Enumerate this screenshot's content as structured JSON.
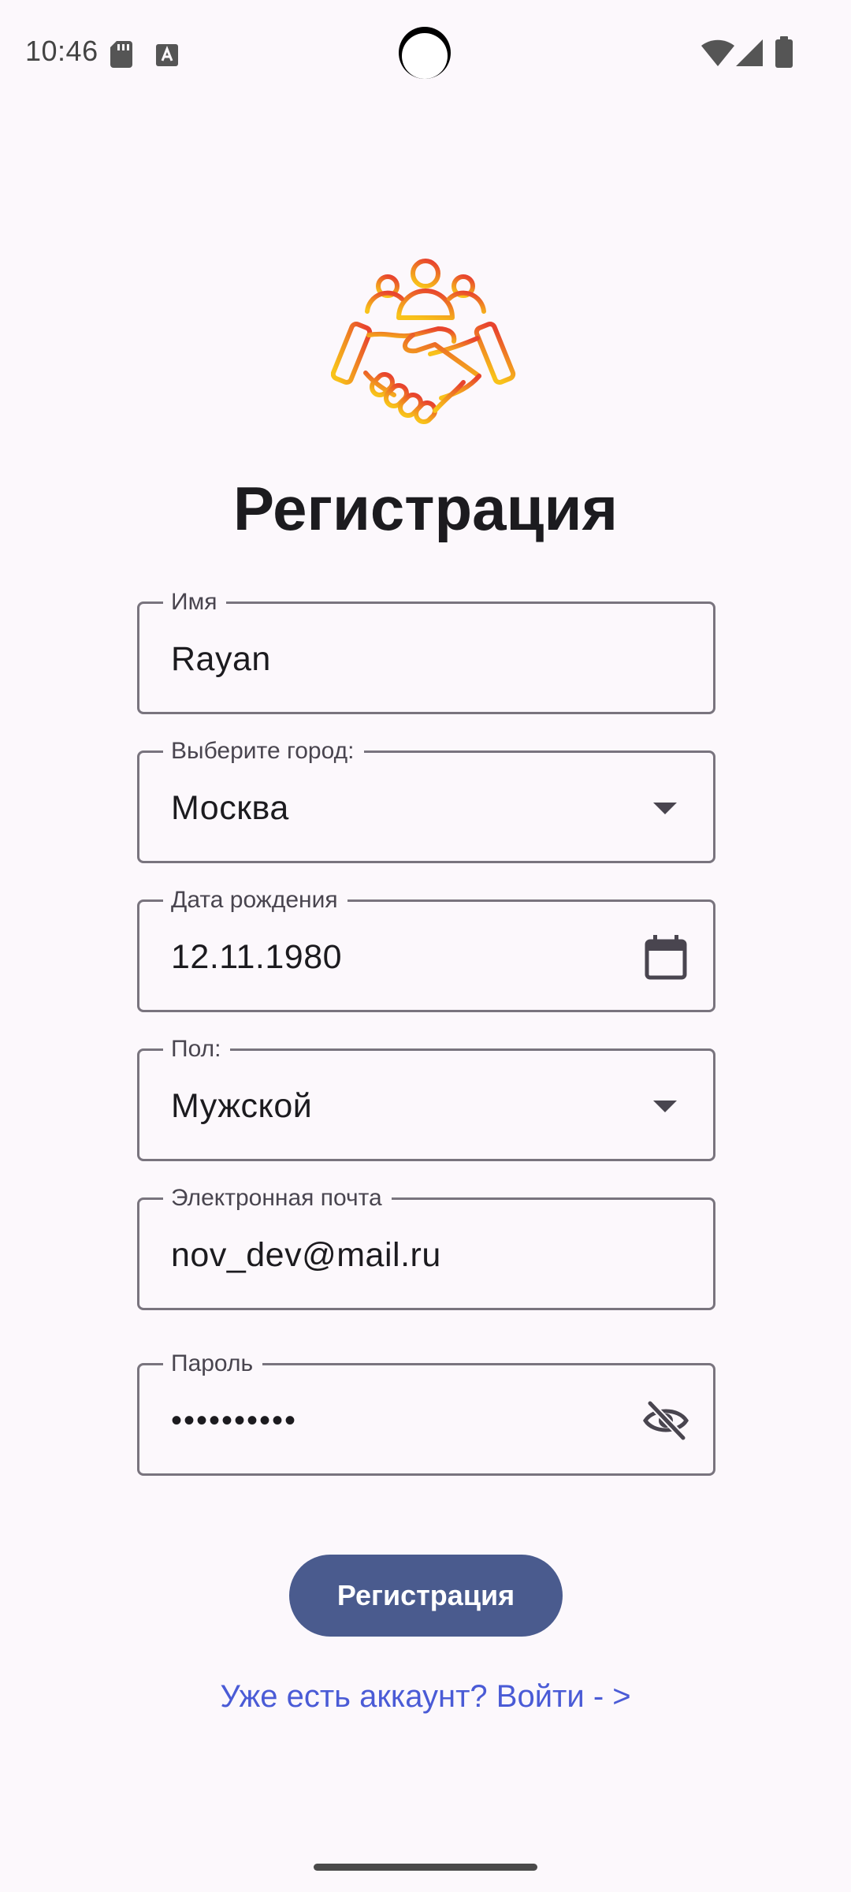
{
  "status_bar": {
    "time": "10:46",
    "icons": [
      "sd-card-icon",
      "keyboard-a-icon",
      "wifi-icon",
      "signal-icon",
      "battery-icon"
    ]
  },
  "logo": {
    "icon": "handshake-people-icon",
    "colors": {
      "top": "#E8442E",
      "bottom": "#F8C21A"
    }
  },
  "title": "Регистрация",
  "form": {
    "name": {
      "label": "Имя",
      "value": "Rayan"
    },
    "city": {
      "label": "Выберите город:",
      "value": "Москва",
      "icon": "dropdown-arrow-icon"
    },
    "birth_date": {
      "label": "Дата рождения",
      "value": "12.11.1980",
      "icon": "calendar-icon"
    },
    "gender": {
      "label": "Пол:",
      "value": "Мужской",
      "icon": "dropdown-arrow-icon"
    },
    "email": {
      "label": "Электронная почта",
      "value": "nov_dev@mail.ru"
    },
    "password": {
      "label": "Пароль",
      "value": "••••••••••",
      "icon": "eye-off-icon"
    }
  },
  "register_button": {
    "label": "Регистрация",
    "color": "#4A5B8E"
  },
  "login_link": {
    "label": "Уже есть аккаунт? Войти - >",
    "color": "#4A5BD6"
  }
}
